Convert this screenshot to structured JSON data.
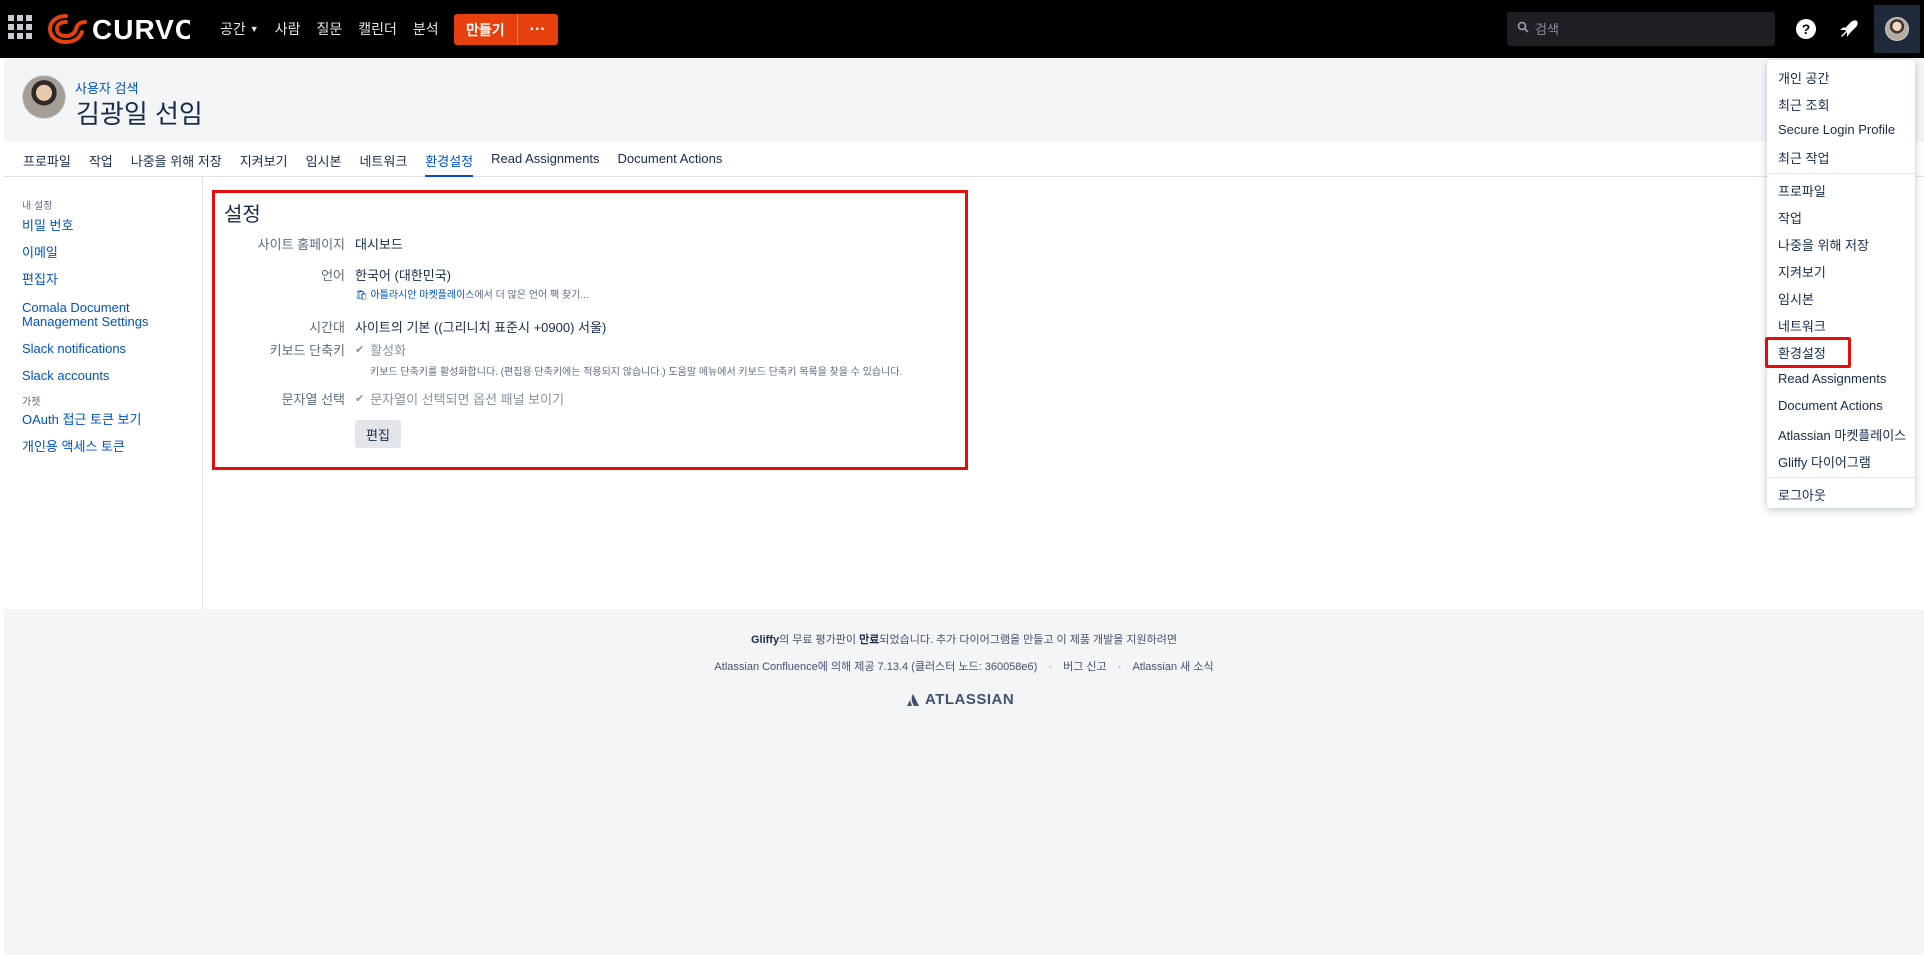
{
  "topnav": {
    "logo_text": "CURVC",
    "items": [
      {
        "label": "공간",
        "dropdown": true
      },
      {
        "label": "사람"
      },
      {
        "label": "질문"
      },
      {
        "label": "캘린더"
      },
      {
        "label": "분석"
      }
    ],
    "create_label": "만들기",
    "create_more_label": "···",
    "search_placeholder": "검색",
    "brand_color": "#e5400d",
    "icons": [
      "help-icon",
      "notifications-icon"
    ]
  },
  "header": {
    "breadcrumb": "사용자 검색",
    "name": "김광일 선임"
  },
  "tabs": [
    {
      "label": "프로파일"
    },
    {
      "label": "작업"
    },
    {
      "label": "나중을 위해 저장"
    },
    {
      "label": "지켜보기"
    },
    {
      "label": "임시본"
    },
    {
      "label": "네트워크"
    },
    {
      "label": "환경설정",
      "active": true
    },
    {
      "label": "Read Assignments"
    },
    {
      "label": "Document Actions"
    }
  ],
  "sidebar": {
    "heading_my_settings": "내 설정",
    "items_a": [
      "비밀 번호",
      "이메일",
      "편집자",
      "Comala Document Management Settings",
      "Slack notifications",
      "Slack accounts"
    ],
    "heading_gadgets": "가젯",
    "items_b": [
      "OAuth 접근 토큰 보기",
      "개인용 액세스 토큰"
    ]
  },
  "settings": {
    "title": "설정",
    "homepage_label": "사이트 홈페이지",
    "homepage_value": "대시보드",
    "language_label": "언어",
    "language_value": "한국어 (대한민국)",
    "language_link": "아틀라시안 마켓플레이스",
    "language_link_suffix": "에서 더 많은 언어 팩 찾기...",
    "timezone_label": "시간대",
    "timezone_value": "사이트의 기본 ((그리니치 표준시 +0900) 서울)",
    "shortcuts_label": "키보드 단축키",
    "shortcuts_value": "활성화",
    "shortcuts_help": "키보드 단축키를 활성화합니다. (편집용 단축키에는 적용되지 않습니다.) 도움말 메뉴에서 키보드 단축키 목록을 찾을 수 있습니다.",
    "selection_label": "문자열 선택",
    "selection_value": "문자열이 선택되면 옵션 패널 보이기",
    "edit_button": "편집",
    "highlight_color": "#e50c0c"
  },
  "footer": {
    "gliffy_name": "Gliffy",
    "gliffy_mid": "의 무료 평가판이 ",
    "gliffy_expired": "만료",
    "gliffy_rest": "되었습니다. 추가 다이어그램을 만들고 이 제품 개발을 지원하려면",
    "powered": "Atlassian Confluence에 의해 제공 7.13.4 (클러스터 노드: 360058e6)",
    "bug": "버그 신고",
    "news": "Atlassian 새 소식",
    "atlassian": "ATLASSIAN"
  },
  "dropdown": {
    "group1": [
      "개인 공간",
      "최근 조회",
      "Secure Login Profile",
      "최근 작업"
    ],
    "group2": [
      "프로파일",
      "작업",
      "나중을 위해 저장",
      "지켜보기",
      "임시본",
      "네트워크",
      "환경설정",
      "Read Assignments",
      "Document Actions",
      "Atlassian 마켓플레이스",
      "Gliffy 다이어그램"
    ],
    "group3": [
      "로그아웃"
    ]
  }
}
